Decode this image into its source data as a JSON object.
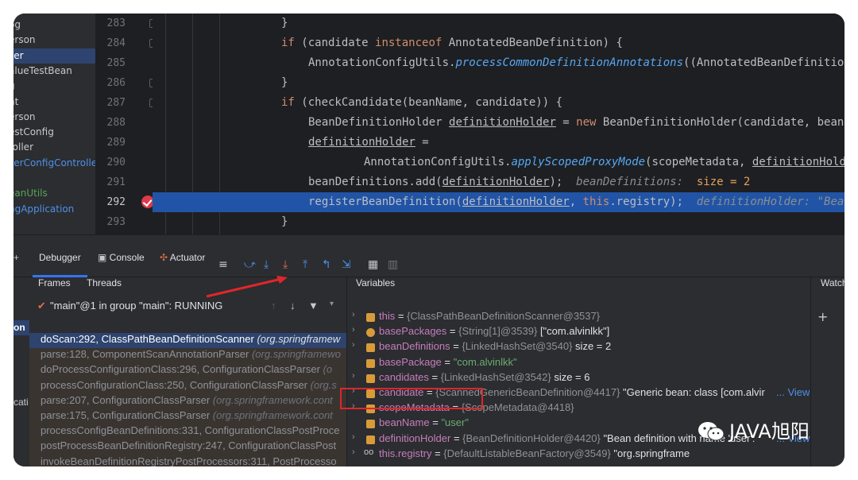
{
  "project_tree": [
    {
      "label": "og",
      "style": "normal"
    },
    {
      "label": "erson",
      "style": "normal"
    },
    {
      "label": "ser",
      "style": "sel"
    },
    {
      "label": "alueTestBean",
      "style": "normal"
    },
    {
      "label": "g",
      "style": "normal"
    },
    {
      "label": "nt",
      "style": "normal"
    },
    {
      "label": "erson",
      "style": "normal"
    },
    {
      "label": "estConfig",
      "style": "normal"
    },
    {
      "label": "roller",
      "style": "normal"
    },
    {
      "label": "serConfigControlle",
      "style": "blue"
    },
    {
      "label": "",
      "style": "normal"
    },
    {
      "label": "eanUtils",
      "style": "green"
    },
    {
      "label": "ngApplication",
      "style": "blue"
    }
  ],
  "line_numbers": [
    "283",
    "284",
    "285",
    "286",
    "287",
    "288",
    "289",
    "290",
    "291",
    "292",
    "293"
  ],
  "current_line": "292",
  "code": {
    "l283": "}",
    "l284_kw1": "if",
    "l284_a": " (candidate ",
    "l284_kw2": "instanceof",
    "l284_b": " AnnotatedBeanDefinition) {",
    "l285_a": "AnnotationConfigUtils.",
    "l285_fn": "processCommonDefinitionAnnotations",
    "l285_b": "((AnnotatedBeanDefinitio",
    "l286": "}",
    "l287_kw": "if",
    "l287_b": " (checkCandidate(beanName, candidate)) {",
    "l288_a": "BeanDefinitionHolder ",
    "l288_ul": "definitionHolder",
    "l288_b": " = ",
    "l288_kw": "new",
    "l288_c": " BeanDefinitionHolder(candidate, bean",
    "l289_ul": "definitionHolder",
    "l289_b": " =",
    "l290_a": "AnnotationConfigUtils.",
    "l290_fn": "applyScopedProxyMode",
    "l290_b": "(scopeMetadata, ",
    "l290_ul": "definitionHold",
    "l291_a": "beanDefinitions.add(",
    "l291_ul": "definitionHolder",
    "l291_b": ");",
    "l291_hint": "beanDefinitions:",
    "l291_size": "size = 2",
    "l292_a": "registerBeanDefinition(",
    "l292_ul": "definitionHolder",
    "l292_b": ", ",
    "l292_kw": "this",
    "l292_c": ".registry);",
    "l292_hint": "definitionHolder: \"Bea",
    "l293": "}"
  },
  "toolbar": {
    "debugger": "Debugger",
    "console": "Console",
    "actuator": "Actuator"
  },
  "frames": {
    "tab_frames": "Frames",
    "tab_threads": "Threads",
    "thread": "\"main\"@1 in group \"main\": RUNNING",
    "side_label_1": "on",
    "side_label_2": "cati",
    "rows": [
      {
        "method": "doScan:292, ClassPathBeanDefinitionScanner",
        "pkg": "(org.springframew",
        "style": "sel"
      },
      {
        "method": "parse:128, ComponentScanAnnotationParser",
        "pkg": "(org.springframewo",
        "style": "lib"
      },
      {
        "method": "doProcessConfigurationClass:296, ConfigurationClassParser",
        "pkg": "(o",
        "style": "lib"
      },
      {
        "method": "processConfigurationClass:250, ConfigurationClassParser",
        "pkg": "(org.s",
        "style": "lib"
      },
      {
        "method": "parse:207, ConfigurationClassParser",
        "pkg": "(org.springframework.cont",
        "style": "lib"
      },
      {
        "method": "parse:175, ConfigurationClassParser",
        "pkg": "(org.springframework.cont",
        "style": "lib"
      },
      {
        "method": "processConfigBeanDefinitions:331, ConfigurationClassPostProce",
        "pkg": "",
        "style": "lib"
      },
      {
        "method": "postProcessBeanDefinitionRegistry:247, ConfigurationClassPost",
        "pkg": "",
        "style": "lib"
      },
      {
        "method": "invokeBeanDefinitionRegistryPostProcessors:311, PostProcesso",
        "pkg": "",
        "style": "lib"
      },
      {
        "method": "invokeBeanFactoryPostProcessors:112, PostProcessorRegistratio",
        "pkg": "",
        "style": "lib"
      }
    ]
  },
  "variables": {
    "title": "Variables",
    "rows": [
      {
        "name": "this",
        "eq": " = ",
        "val": "{ClassPathBeanDefinitionScanner@3537}",
        "extra": "",
        "str": "",
        "icon": "field"
      },
      {
        "name": "basePackages",
        "eq": " = ",
        "val": "{String[1]@3539}",
        "extra": " [\"com.alvinlkk\"]",
        "str": "",
        "icon": "param"
      },
      {
        "name": "beanDefinitions",
        "eq": " = ",
        "val": "{LinkedHashSet@3540}",
        "extra": "  size = 2",
        "str": "",
        "icon": "field"
      },
      {
        "name": "basePackage",
        "eq": " = ",
        "val": "",
        "extra": "",
        "str": "\"com.alvinlkk\"",
        "icon": "field"
      },
      {
        "name": "candidates",
        "eq": " = ",
        "val": "{LinkedHashSet@3542}",
        "extra": "  size = 6",
        "str": "",
        "icon": "field"
      },
      {
        "name": "candidate",
        "eq": " = ",
        "val": "{ScannedGenericBeanDefinition@4417}",
        "extra": " \"Generic bean: class [com.alvir",
        "str": "",
        "icon": "field",
        "link": "... View"
      },
      {
        "name": "scopeMetadata",
        "eq": " = ",
        "val": "{ScopeMetadata@4418}",
        "extra": "",
        "str": "",
        "icon": "field"
      },
      {
        "name": "beanName",
        "eq": " = ",
        "val": "",
        "extra": "",
        "str": "\"user\"",
        "icon": "field"
      },
      {
        "name": "definitionHolder",
        "eq": " = ",
        "val": "{BeanDefinitionHolder@4420}",
        "extra": " \"Bean definition with name 'user':",
        "str": "",
        "icon": "field",
        "link": "... View"
      },
      {
        "name": "this.registry",
        "eq": " = ",
        "val": "{DefaultListableBeanFactory@3549}",
        "extra": " \"org.springframe",
        "str": "",
        "icon": "oo"
      }
    ]
  },
  "watches": {
    "title": "Watch"
  },
  "watermark": "JAVA旭阳",
  "colors": {
    "highlight": "#2154a6",
    "breakpoint": "#db3b4b",
    "annotation_box": "#e0262a"
  }
}
